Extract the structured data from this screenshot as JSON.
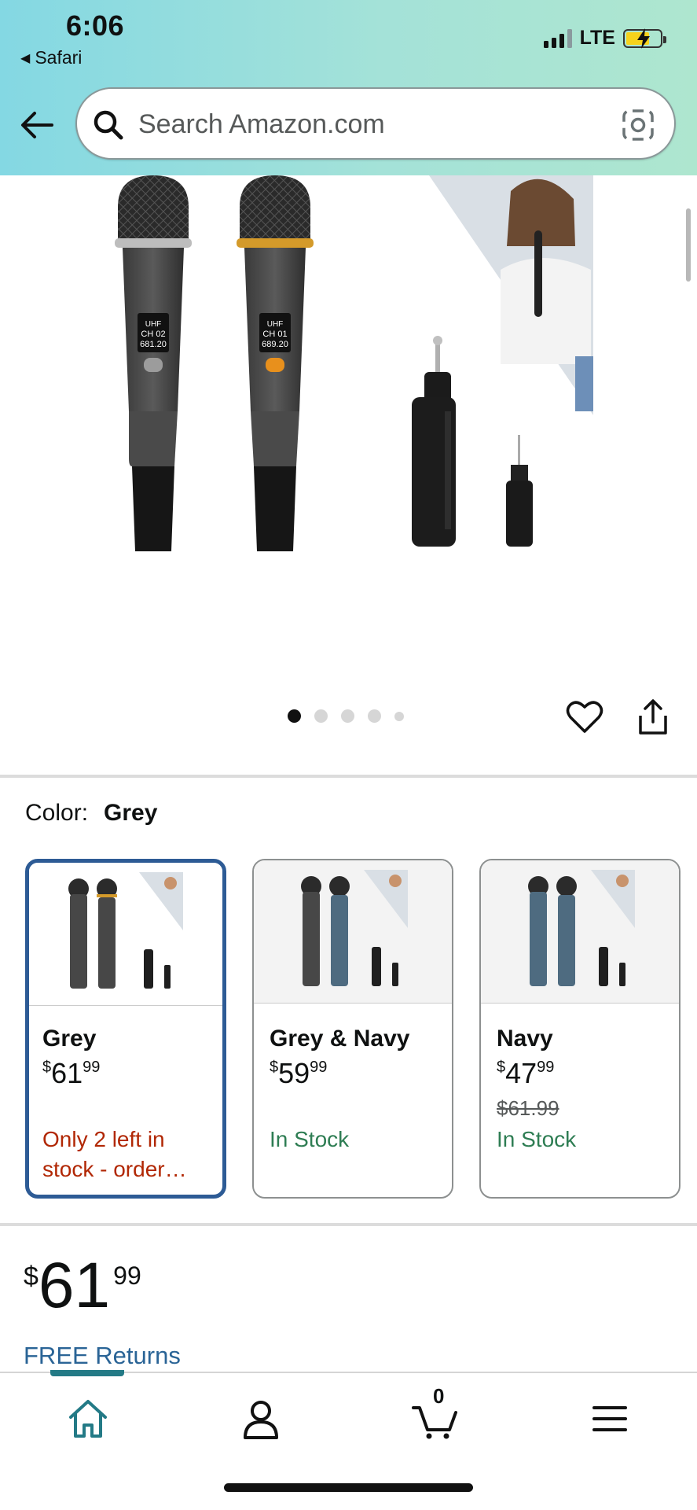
{
  "status_bar": {
    "time": "6:06",
    "back_app": "Safari",
    "network": "LTE"
  },
  "search": {
    "placeholder": "Search Amazon.com"
  },
  "gallery": {
    "image_count": 5,
    "active_index": 0
  },
  "color_selector": {
    "label": "Color:",
    "selected": "Grey"
  },
  "variants": [
    {
      "name": "Grey",
      "price_symbol": "$",
      "price_whole": "61",
      "price_fraction": "99",
      "stock": "Only 2 left in stock - order…",
      "list_price": ""
    },
    {
      "name": "Grey & Navy",
      "price_symbol": "$",
      "price_whole": "59",
      "price_fraction": "99",
      "stock": "In Stock",
      "list_price": ""
    },
    {
      "name": "Navy",
      "price_symbol": "$",
      "price_whole": "47",
      "price_fraction": "99",
      "stock": "In Stock",
      "list_price": "$61.99"
    }
  ],
  "price": {
    "symbol": "$",
    "whole": "61",
    "fraction": "99"
  },
  "returns_link": "FREE Returns",
  "bottom_nav": {
    "cart_count": "0",
    "items": [
      "home-icon",
      "account-icon",
      "cart-icon",
      "menu-icon"
    ]
  },
  "colors": {
    "accent": "#237a86",
    "selected_border": "#2d5b95",
    "low_stock": "#b12704",
    "in_stock": "#2e7d53",
    "link": "#2a6496"
  }
}
